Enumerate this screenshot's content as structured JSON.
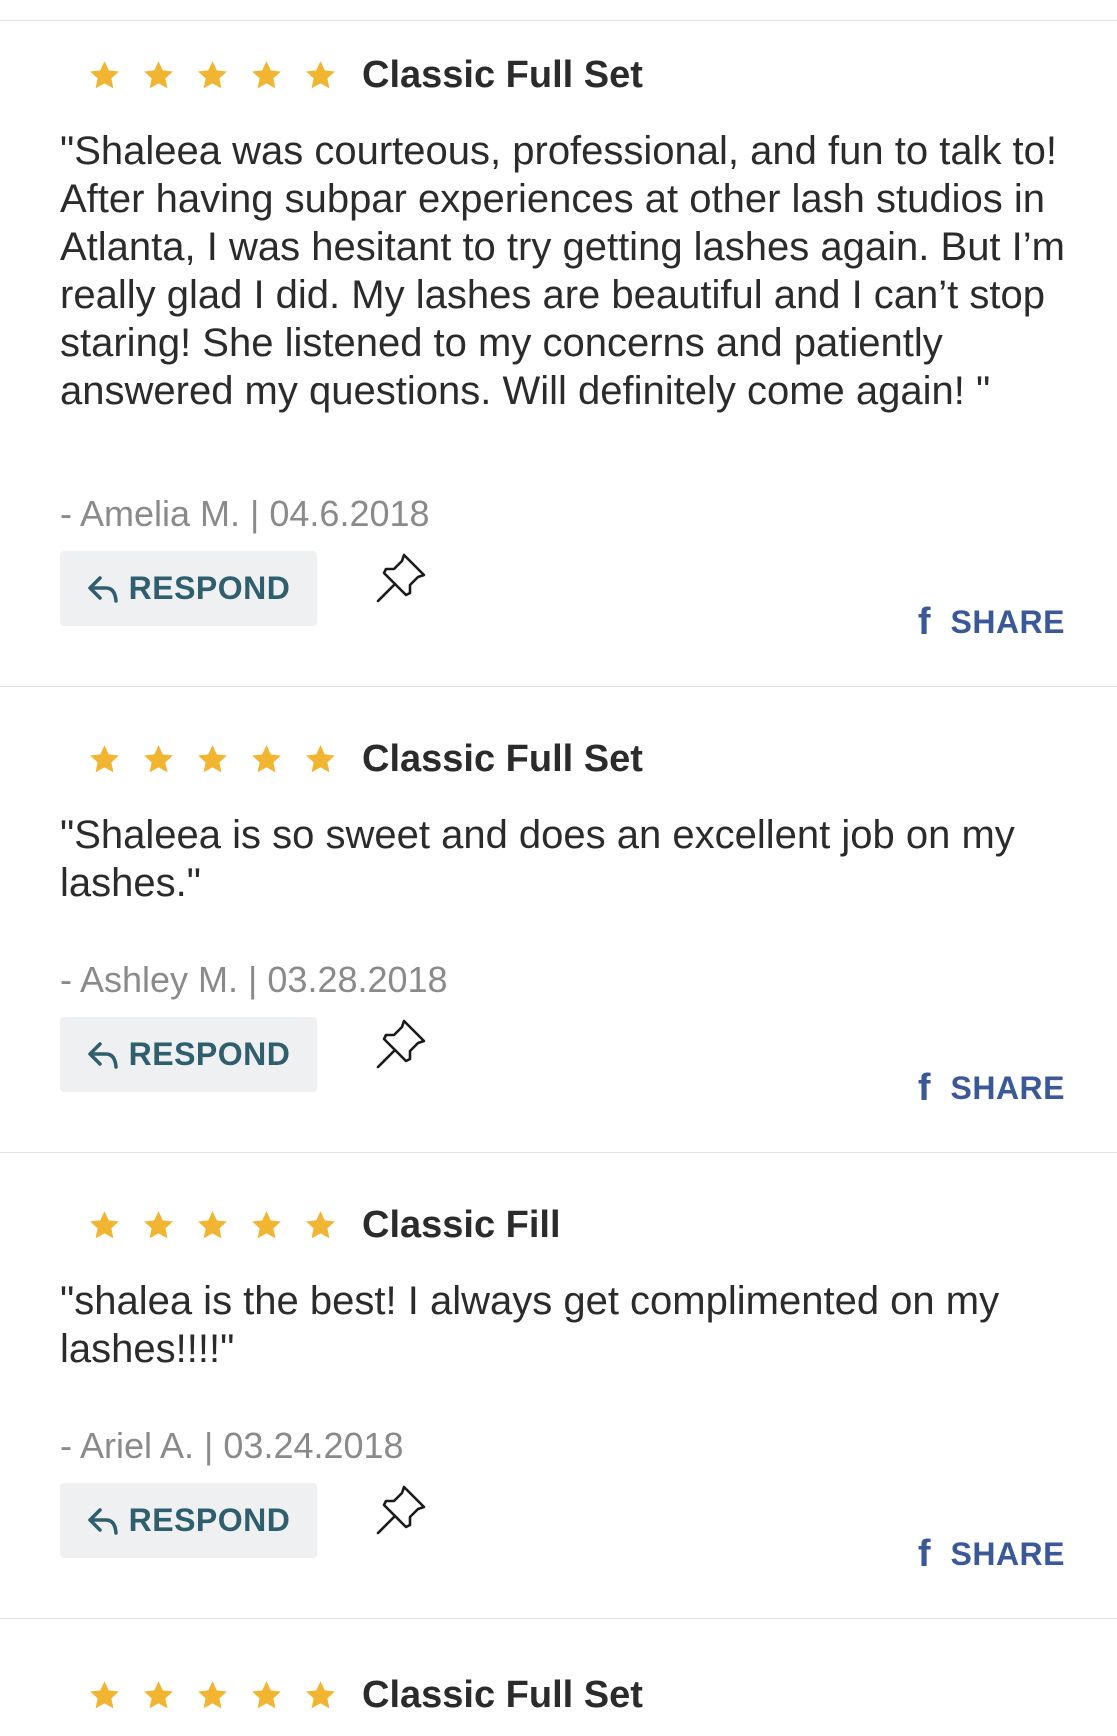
{
  "colors": {
    "star": "#f2b532",
    "respond_text": "#2f5e6e",
    "respond_bg": "#eef0f1",
    "share_text": "#3b5998",
    "byline_text": "#8a8a8a",
    "divider": "#e2e2e2"
  },
  "icons": {
    "star": "star-icon",
    "respond": "reply-arrow-icon",
    "pin": "pushpin-icon",
    "share": "facebook-icon"
  },
  "reviews": [
    {
      "rating": 5,
      "service": "Classic Full Set",
      "quote": "\"Shaleea was courteous, professional, and fun to talk to! After having subpar experiences at other lash studios in Atlanta, I was hesitant to try getting lashes again. But I’m really glad I did. My lashes are beautiful and I can’t stop staring! She listened to my concerns and patiently answered my questions. Will definitely come again! \"",
      "byline": "- Amelia M. | 04.6.2018",
      "respond_label": "RESPOND",
      "share_icon": "f",
      "share_label": "SHARE"
    },
    {
      "rating": 5,
      "service": "Classic Full Set",
      "quote": "\"Shaleea is so sweet and does an excellent job on my lashes.\"",
      "byline": "- Ashley M. | 03.28.2018",
      "respond_label": "RESPOND",
      "share_icon": "f",
      "share_label": "SHARE"
    },
    {
      "rating": 5,
      "service": "Classic Fill",
      "quote": "\"shalea is the best! I always get complimented on my lashes!!!!\"",
      "byline": "- Ariel A. | 03.24.2018",
      "respond_label": "RESPOND",
      "share_icon": "f",
      "share_label": "SHARE"
    },
    {
      "rating": 5,
      "service": "Classic Full Set"
    }
  ]
}
